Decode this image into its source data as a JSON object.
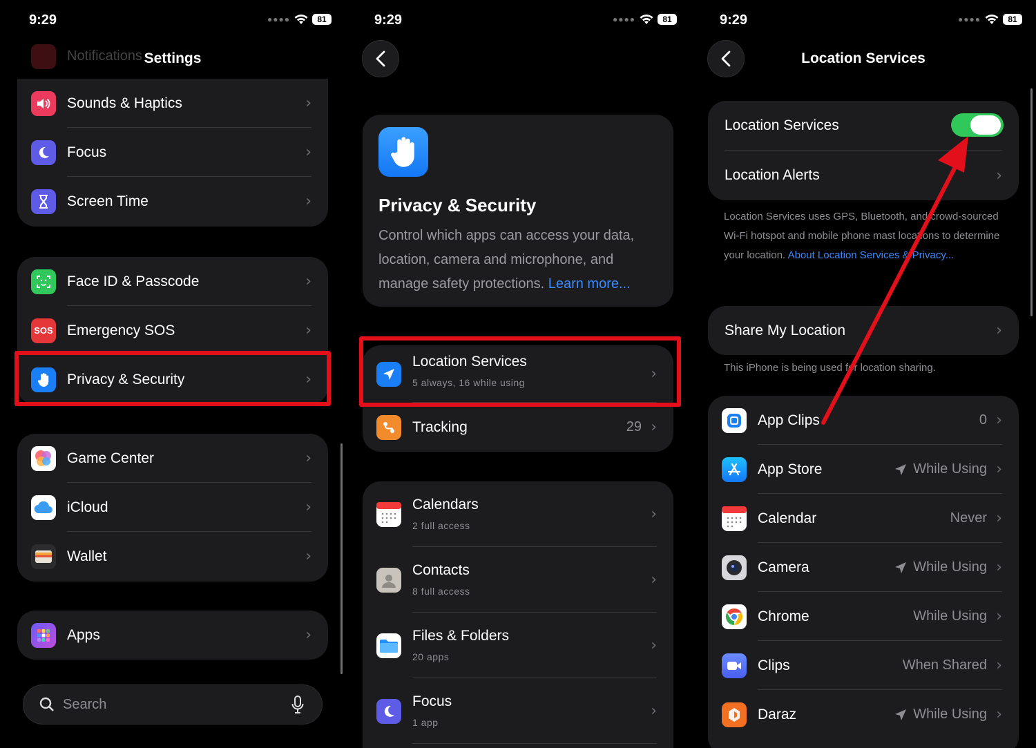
{
  "status": {
    "time": "9:29",
    "battery": "81"
  },
  "panel1": {
    "title": "Settings",
    "faded_item": "Notifications",
    "group1": [
      {
        "label": "Sounds & Haptics",
        "icon": "speaker-icon",
        "color": "#ec3a5d"
      },
      {
        "label": "Focus",
        "icon": "moon-icon",
        "color": "#5e5ce6"
      },
      {
        "label": "Screen Time",
        "icon": "hourglass-icon",
        "color": "#5e5ce6"
      }
    ],
    "group2": [
      {
        "label": "Face ID & Passcode",
        "icon": "face-id-icon",
        "color": "#30c85a"
      },
      {
        "label": "Emergency SOS",
        "icon": "sos-icon",
        "color": "#e5363a",
        "icon_text": "SOS"
      },
      {
        "label": "Privacy & Security",
        "icon": "hand-icon",
        "color": "#1a7ef5"
      }
    ],
    "group3": [
      {
        "label": "Game Center",
        "icon": "game-center-icon"
      },
      {
        "label": "iCloud",
        "icon": "cloud-icon"
      },
      {
        "label": "Wallet",
        "icon": "wallet-icon"
      }
    ],
    "group4": [
      {
        "label": "Apps",
        "icon": "apps-grid-icon"
      }
    ],
    "search_placeholder": "Search"
  },
  "panel2": {
    "header_title": "Privacy & Security",
    "header_desc": "Control which apps can access your data, location, camera and microphone, and manage safety protections.",
    "header_link": "Learn more...",
    "location": {
      "label": "Location Services",
      "sub": "5 always, 16 while using"
    },
    "tracking": {
      "label": "Tracking",
      "value": "29"
    },
    "apps": [
      {
        "label": "Calendars",
        "sub": "2 full access",
        "icon": "calendar-icon"
      },
      {
        "label": "Contacts",
        "sub": "8 full access",
        "icon": "contacts-icon"
      },
      {
        "label": "Files & Folders",
        "sub": "20 apps",
        "icon": "folder-icon"
      },
      {
        "label": "Focus",
        "sub": "1 app",
        "icon": "moon-icon"
      }
    ]
  },
  "panel3": {
    "title": "Location Services",
    "toggle_label": "Location Services",
    "toggle_on": true,
    "alerts_label": "Location Alerts",
    "info_text": "Location Services uses GPS, Bluetooth, and crowd-sourced Wi-Fi hotspot and mobile phone mast locations to determine your location.",
    "info_link": "About Location Services & Privacy...",
    "share_label": "Share My Location",
    "share_note": "This iPhone is being used for location sharing.",
    "apps": [
      {
        "label": "App Clips",
        "value": "0",
        "arrow": false,
        "icon": "app-clips-icon"
      },
      {
        "label": "App Store",
        "value": "While Using",
        "arrow": true,
        "icon": "app-store-icon"
      },
      {
        "label": "Calendar",
        "value": "Never",
        "arrow": false,
        "icon": "calendar-icon"
      },
      {
        "label": "Camera",
        "value": "While Using",
        "arrow": true,
        "icon": "camera-icon"
      },
      {
        "label": "Chrome",
        "value": "While Using",
        "arrow": false,
        "icon": "chrome-icon"
      },
      {
        "label": "Clips",
        "value": "When Shared",
        "arrow": false,
        "icon": "clips-icon"
      },
      {
        "label": "Daraz",
        "value": "While Using",
        "arrow": true,
        "icon": "daraz-icon"
      }
    ]
  },
  "colors": {
    "highlight": "#e3101c",
    "toggle_on": "#30c85a",
    "link": "#3a8bff",
    "cell": "#1c1c1e"
  }
}
